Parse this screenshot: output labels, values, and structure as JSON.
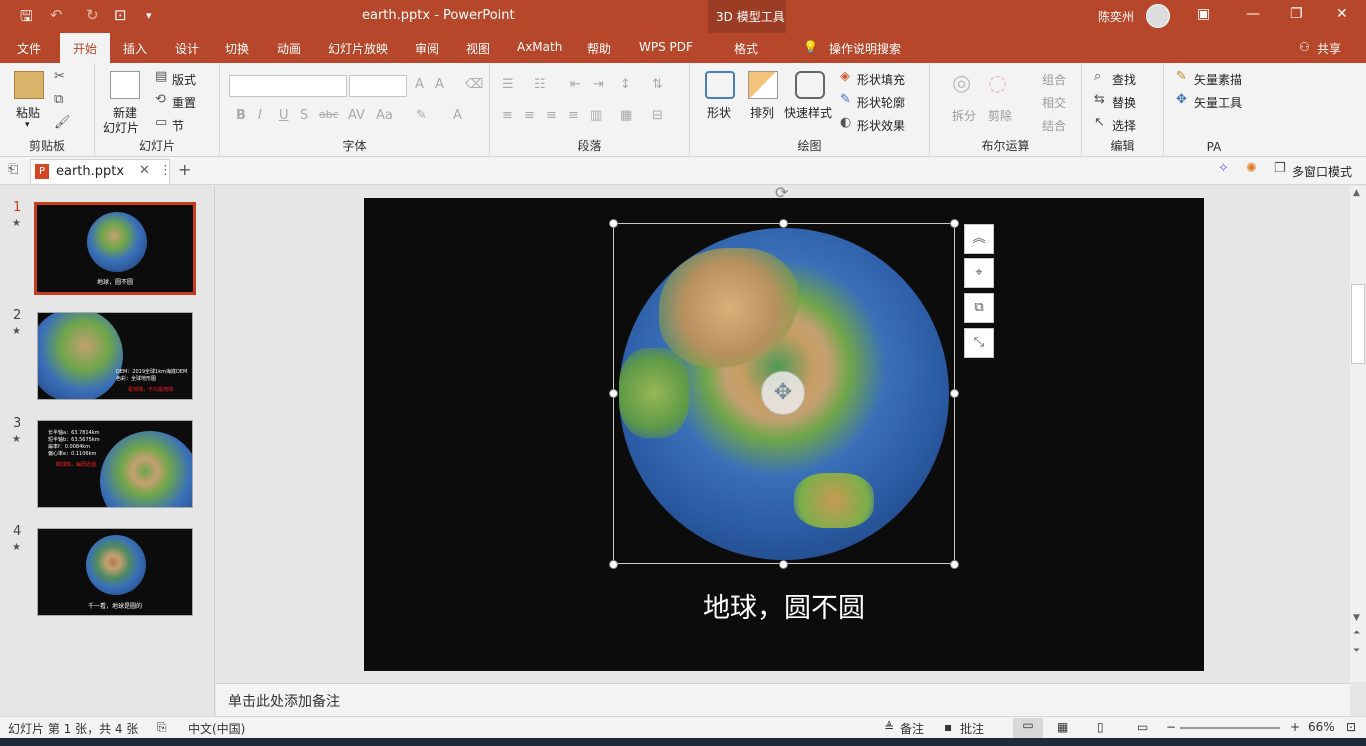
{
  "titlebar": {
    "title": "earth.pptx  -  PowerPoint",
    "context_tool": "3D 模型工具",
    "user": "陈奕州"
  },
  "tabs": {
    "file": "文件",
    "home": "开始",
    "insert": "插入",
    "design": "设计",
    "transitions": "切换",
    "animations": "动画",
    "slideshow": "幻灯片放映",
    "review": "审阅",
    "view": "视图",
    "axmath": "AxMath",
    "help": "帮助",
    "wpspdf": "WPS PDF",
    "format": "格式",
    "tellme": "操作说明搜索",
    "share": "共享"
  },
  "ribbon": {
    "clipboard": {
      "paste": "粘贴",
      "label": "剪贴板"
    },
    "slides": {
      "new_slide_l1": "新建",
      "new_slide_l2": "幻灯片",
      "layout": "版式",
      "reset": "重置",
      "section": "节",
      "label": "幻灯片"
    },
    "font": {
      "label": "字体"
    },
    "paragraph": {
      "label": "段落"
    },
    "drawing": {
      "shape": "形状",
      "arrange": "排列",
      "quick_styles": "快速样式",
      "fill": "形状填充",
      "outline": "形状轮廓",
      "effects": "形状效果",
      "label": "绘图"
    },
    "boolean": {
      "split": "拆分",
      "trim": "剪除",
      "combine": "组合",
      "intersect": "相交",
      "union": "结合",
      "label": "布尔运算"
    },
    "editing": {
      "find": "查找",
      "replace": "替换",
      "select": "选择",
      "label": "编辑"
    },
    "pa": {
      "vector_draw": "矢量素描",
      "vector_tools": "矢量工具",
      "label": "PA"
    }
  },
  "doctab": {
    "name": "earth.pptx",
    "multiwindow": "多窗口模式"
  },
  "thumbnails": [
    {
      "num": "1",
      "star": "★",
      "caption": "地球，圆不圆"
    },
    {
      "num": "2",
      "star": "★",
      "line1": "DEM：2019全球1km海底DEM",
      "line2": "色彩：全球地形图",
      "line3": "看地球，不只是地球"
    },
    {
      "num": "3",
      "star": "★",
      "line1": "长半轴a：63.7814km",
      "line2": "短半轴b：63.5675km",
      "line3": "扁率f：0.0084km",
      "line4": "偏心率e：0.1106km",
      "red": "椭球体，扁而近圆"
    },
    {
      "num": "4",
      "star": "★",
      "caption": "千一看，地球是圆的"
    }
  ],
  "slide": {
    "caption": "地球，圆不圆"
  },
  "notes": {
    "placeholder": "单击此处添加备注"
  },
  "statusbar": {
    "slide_info": "幻灯片 第 1 张，共 4 张",
    "language": "中文(中国)",
    "notes": "备注",
    "comments": "批注",
    "zoom": "66%"
  }
}
